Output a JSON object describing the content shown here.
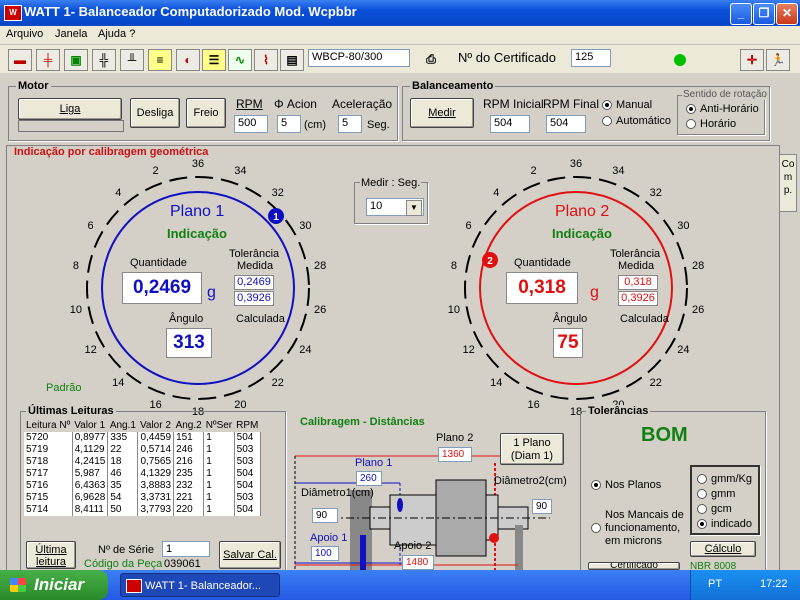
{
  "window": {
    "title": "WATT 1- Balanceador Computadorizado  Mod. Wcpbbr",
    "icon": "WATT-app-icon"
  },
  "menu": [
    "Arquivo",
    "Janela",
    "Ajuda ?"
  ],
  "toolbar": {
    "machine": "WBCP-80/300",
    "cert_label": "Nº do Certificado",
    "cert_value": "125",
    "status_color": "#00c000"
  },
  "motor": {
    "title": "Motor",
    "liga": "Liga",
    "desliga": "Desliga",
    "freio": "Freio",
    "rpm_label": "RPM",
    "rpm": "500",
    "acion_label": "Φ Acion",
    "acion": "5",
    "acion_unit": "(cm)",
    "acel_label": "Aceleração",
    "acel": "5",
    "acel_unit": "Seg."
  },
  "balanc": {
    "title": "Balanceamento",
    "medir": "Medir",
    "rpm_ini_label": "RPM Inicial",
    "rpm_ini": "504",
    "rpm_fin_label": "RPM Final",
    "rpm_fin": "504",
    "manual": "Manual",
    "automatico": "Automático",
    "sentido_title": "Sentido de rotação",
    "anti": "Anti-Horário",
    "horario": "Horário"
  },
  "main": {
    "title": "Indicação por calibragem geométrica",
    "comp": "Comp.",
    "medir_seg": "Medir : Seg.",
    "medir_seg_val": "10",
    "padrao": "Padrão"
  },
  "angles": [
    "36",
    "34",
    "32",
    "30",
    "28",
    "26",
    "24",
    "22",
    "20",
    "18",
    "16",
    "14",
    "12",
    "10",
    "8",
    "6",
    "4",
    "2"
  ],
  "plano1": {
    "title": "Plano 1",
    "ind": "Indicação",
    "qtd_label": "Quantidade",
    "qtd": "0,2469",
    "unit": "g",
    "tol_label": "Tolerância",
    "medida_label": "Medida",
    "tol_medida": "0,2469",
    "tol_calc": "0,3926",
    "calc_label": "Calculada",
    "ang_label": "Ângulo",
    "ang": "313",
    "marker": "1",
    "color": "#1010c0"
  },
  "plano2": {
    "title": "Plano 2",
    "ind": "Indicação",
    "qtd_label": "Quantidade",
    "qtd": "0,318",
    "unit": "g",
    "tol_label": "Tolerância",
    "medida_label": "Medida",
    "tol_medida": "0,318",
    "tol_calc": "0,3926",
    "calc_label": "Calculada",
    "ang_label": "Ângulo",
    "ang": "75",
    "marker": "2",
    "color": "#e01010"
  },
  "leituras": {
    "title": "Últimas Leituras",
    "headers": [
      "Leitura Nº",
      "Valor 1",
      "Ang.1",
      "Valor 2",
      "Ang.2",
      "NºSer",
      "RPM"
    ],
    "rows": [
      [
        "5720",
        "0,8977",
        "335",
        "0,4459",
        "151",
        "1",
        "504"
      ],
      [
        "5719",
        "4,1129",
        "22",
        "0,5714",
        "246",
        "1",
        "503"
      ],
      [
        "5718",
        "4,2415",
        "18",
        "0,7565",
        "216",
        "1",
        "503"
      ],
      [
        "5717",
        "5,987",
        "46",
        "4,1329",
        "235",
        "1",
        "504"
      ],
      [
        "5716",
        "6,4363",
        "35",
        "3,8883",
        "232",
        "1",
        "504"
      ],
      [
        "5715",
        "6,9628",
        "54",
        "3,3731",
        "221",
        "1",
        "503"
      ],
      [
        "5714",
        "8,4111",
        "50",
        "3,7793",
        "220",
        "1",
        "504"
      ]
    ],
    "ultima": "Última leitura",
    "serie_label": "Nº de Série",
    "serie": "1",
    "codigo": "Código da Peça",
    "codigo_val": "039061",
    "salvar": "Salvar Cal."
  },
  "calib": {
    "title": "Calibragem - Distâncias",
    "plano2_label": "Plano 2",
    "plano2_val": "1360",
    "plano1_label": "Plano 1",
    "plano1_val": "260",
    "diam1_label": "Diâmetro1(cm)",
    "diam1": "90",
    "diam2_label": "Diâmetro2(cm)",
    "diam2": "90",
    "apoio1_label": "Apoio 1",
    "apoio1": "100",
    "apoio2_label": "Apoio 2",
    "apoio2": "1480",
    "btn1": "1 Plano",
    "btn2": "(Diam 1)"
  },
  "tol": {
    "title": "Tolerâncias",
    "status": "BOM",
    "status_color": "#108010",
    "nos_planos": "Nos Planos",
    "nos_mancais": "Nos Mancais de funcionamento, em microns",
    "opts": [
      "gmm/Kg",
      "gmm",
      "gcm",
      "indicado"
    ],
    "calculo": "Cálculo",
    "certificado": "Certificado",
    "nbr": "NBR 8008"
  },
  "taskbar": {
    "start": "Iniciar",
    "task": "WATT 1- Balanceador...",
    "lang": "PT",
    "clock": "17:22"
  }
}
